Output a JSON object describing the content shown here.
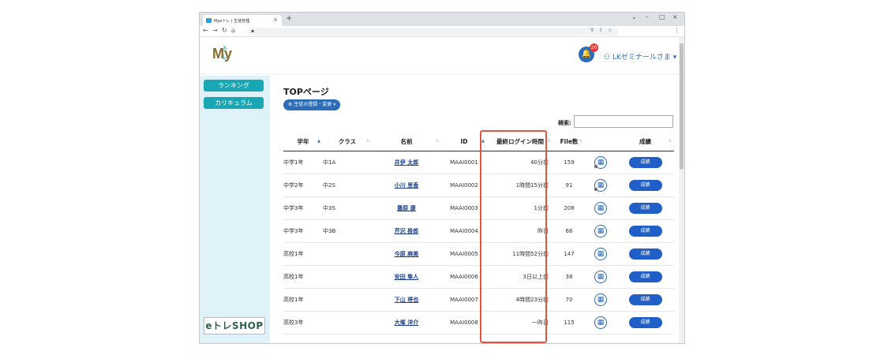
{
  "browser": {
    "tab_title": "Myeトレ | 生徒管理",
    "tab_close": "×",
    "new_tab": "+",
    "window_minimize": "–",
    "window_maximize": "□",
    "window_close": "×",
    "address_icons": [
      "search-icon",
      "share-icon",
      "star-icon"
    ]
  },
  "header": {
    "logo_text": "My",
    "logo_sub": "トレ",
    "notification_count": "26",
    "user_name": "LKゼミナールさま"
  },
  "sidebar": {
    "items": [
      {
        "label": "ランキング"
      },
      {
        "label": "カリキュラム"
      }
    ],
    "shop_label": "eトレSHOP"
  },
  "main": {
    "page_title": "TOPページ",
    "student_button": "生徒の登録・変更",
    "search_label": "検索:",
    "search_value": "",
    "columns": [
      "学年",
      "クラス",
      "名前",
      "ID",
      "最終ログイン時間",
      "File数",
      "",
      "成績"
    ],
    "rows": [
      {
        "grade": "中学1年",
        "class": "中1A",
        "name": "井伊 太郎",
        "id": "MAAI0001",
        "last_login": "40分前",
        "files": "159",
        "dot": true,
        "button": "成績"
      },
      {
        "grade": "中学2年",
        "class": "中2S",
        "name": "小川 里香",
        "id": "MAAI0002",
        "last_login": "1時間15分前",
        "files": "91",
        "dot": true,
        "button": "成績"
      },
      {
        "grade": "中学3年",
        "class": "中3S",
        "name": "藤原 康",
        "id": "MAAI0003",
        "last_login": "1分前",
        "files": "208",
        "dot": false,
        "button": "成績"
      },
      {
        "grade": "中学3年",
        "class": "中3B",
        "name": "芹沢 掛郎",
        "id": "MAAI0004",
        "last_login": "昨日",
        "files": "66",
        "dot": false,
        "button": "成績"
      },
      {
        "grade": "高校1年",
        "class": "",
        "name": "今原 麻美",
        "id": "MAAI0005",
        "last_login": "11時間52分前",
        "files": "147",
        "dot": false,
        "button": "成績"
      },
      {
        "grade": "高校1年",
        "class": "",
        "name": "安田 隼人",
        "id": "MAAI0006",
        "last_login": "3日以上前",
        "files": "38",
        "dot": false,
        "button": "成績"
      },
      {
        "grade": "高校1年",
        "class": "",
        "name": "下山 将也",
        "id": "MAAI0007",
        "last_login": "4時間23分前",
        "files": "70",
        "dot": false,
        "button": "成績"
      },
      {
        "grade": "高校3年",
        "class": "",
        "name": "大塚 洋介",
        "id": "MAAI0008",
        "last_login": "一昨日",
        "files": "115",
        "dot": false,
        "button": "成績"
      }
    ]
  },
  "colors": {
    "accent": "#1aa7b5",
    "primary": "#2d6cb6",
    "highlight": "#e2543f"
  }
}
